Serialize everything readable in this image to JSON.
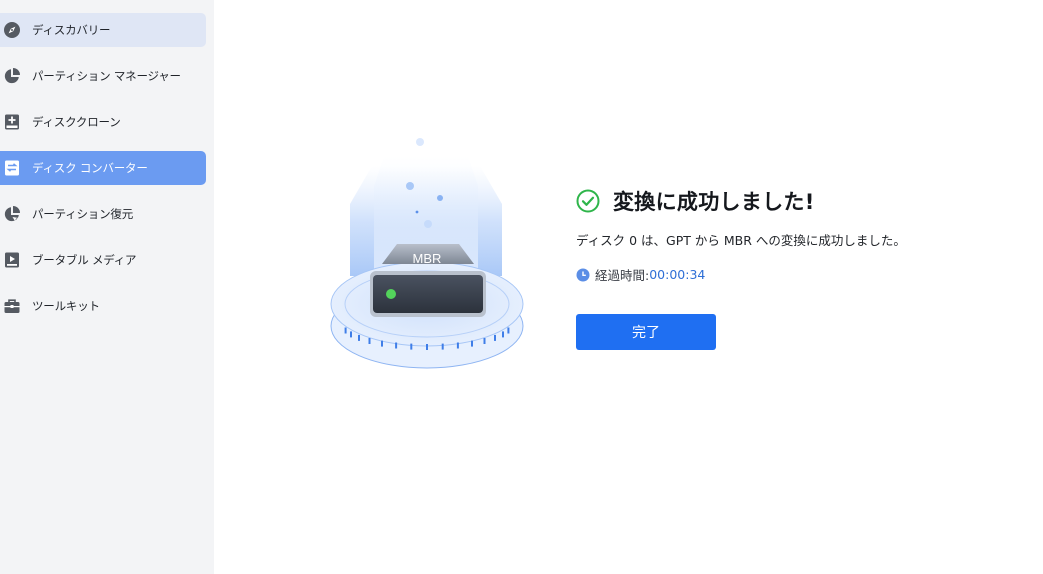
{
  "sidebar": {
    "items": [
      {
        "label": "ディスカバリー",
        "icon": "compass-icon"
      },
      {
        "label": "パーティション マネージャー",
        "icon": "pie-chart-icon"
      },
      {
        "label": "ディスククローン",
        "icon": "disk-clone-icon"
      },
      {
        "label": "ディスク コンバーター",
        "icon": "disk-convert-icon"
      },
      {
        "label": "パーティション復元",
        "icon": "partition-recovery-icon"
      },
      {
        "label": "ブータブル メディア",
        "icon": "bootable-media-icon"
      },
      {
        "label": "ツールキット",
        "icon": "toolbox-icon"
      }
    ],
    "selected_index": 0,
    "active_index": 3
  },
  "illustration": {
    "disk_label": "MBR"
  },
  "result": {
    "title": "変換に成功しました!",
    "description": "ディスク 0 は、GPT から MBR への変換に成功しました。",
    "elapsed_label": "経過時間: ",
    "elapsed_value": "00:00:34",
    "done_label": "完了"
  },
  "colors": {
    "accent": "#1f6ff2",
    "sidebar_active": "#6b9bf1",
    "sidebar_selected": "#dfe6f5",
    "success": "#2fb54b"
  }
}
